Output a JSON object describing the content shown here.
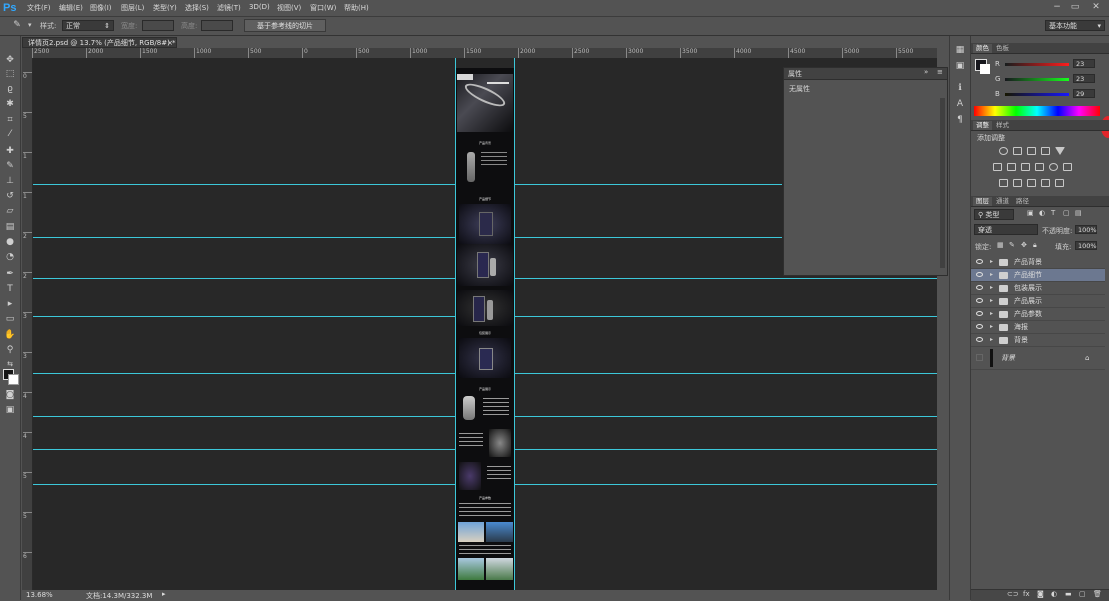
{
  "app": {
    "logo": "Ps"
  },
  "menu": [
    "文件(F)",
    "编辑(E)",
    "图像(I)",
    "图层(L)",
    "类型(Y)",
    "选择(S)",
    "滤镜(T)",
    "3D(D)",
    "视图(V)",
    "窗口(W)",
    "帮助(H)"
  ],
  "window_controls": {
    "minimize": "−",
    "restore": "▭",
    "close": "✕"
  },
  "options_bar": {
    "style_label": "样式:",
    "style_value": "正常",
    "width_label": "宽度:",
    "height_label": "高度:",
    "slice_button": "基于参考线的切片",
    "workspace": "基本功能"
  },
  "document": {
    "tab_title": "详情页2.psd @ 13.7% (产品细节, RGB/8#) *",
    "close": "×",
    "ruler_h": [
      "2500",
      "2000",
      "1500",
      "1000",
      "500",
      "0",
      "500",
      "1000",
      "1500",
      "2000",
      "2500",
      "3000",
      "3500",
      "4000",
      "4500",
      "5000",
      "5500"
    ],
    "ruler_v": [
      "0",
      "5",
      "1",
      "1",
      "2",
      "2",
      "3",
      "3",
      "4",
      "4",
      "5",
      "5",
      "6"
    ],
    "zoom": "13.68%",
    "doc_size": "文档:14.3M/332.3M",
    "page_sections": [
      "产品背景",
      "产品细节",
      "包装展示",
      "产品展示",
      "产品参数"
    ]
  },
  "properties_panel": {
    "title": "属性",
    "content": "无属性"
  },
  "color_panel": {
    "tabs": [
      "颜色",
      "色板"
    ],
    "r_label": "R",
    "g_label": "G",
    "b_label": "B",
    "r_value": "23",
    "g_value": "23",
    "b_value": "29",
    "accent": "#e0262b"
  },
  "adjust_panel": {
    "tabs": [
      "调整",
      "样式"
    ],
    "title": "添加调整"
  },
  "layers_panel": {
    "tabs": [
      "图层",
      "通道",
      "路径"
    ],
    "filter_kind": "类型",
    "blend_mode": "穿透",
    "opacity_label": "不透明度:",
    "opacity_value": "100%",
    "lock_label": "锁定:",
    "fill_label": "填充:",
    "fill_value": "100%",
    "layers": [
      {
        "name": "产品背景",
        "selected": false
      },
      {
        "name": "产品细节",
        "selected": true
      },
      {
        "name": "包装展示",
        "selected": false
      },
      {
        "name": "产品展示",
        "selected": false
      },
      {
        "name": "产品参数",
        "selected": false
      },
      {
        "name": "海报",
        "selected": false
      },
      {
        "name": "背景",
        "selected": false
      }
    ],
    "bg_layer": "背景"
  }
}
